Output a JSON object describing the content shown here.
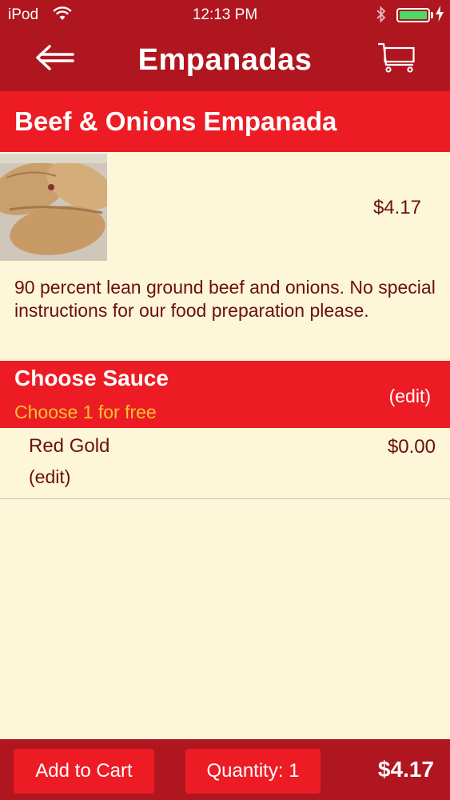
{
  "status_bar": {
    "carrier": "iPod",
    "time": "12:13 PM",
    "battery_level": 1.0,
    "icons": [
      "wifi-icon",
      "bluetooth-icon",
      "battery-icon",
      "charging-icon"
    ]
  },
  "nav": {
    "title": "Empanadas",
    "back_icon": "back-arrow-icon",
    "cart_icon": "cart-icon"
  },
  "product": {
    "name": "Beef & Onions Empanada",
    "price": "$4.17",
    "description": "90 percent lean ground beef and onions. No special instructions for our food preparation please."
  },
  "sauce_section": {
    "title": "Choose Sauce",
    "subtitle": "Choose 1 for free",
    "edit_label": "(edit)",
    "options": [
      {
        "name": "Red Gold",
        "edit_label": "(edit)",
        "price": "$0.00"
      }
    ]
  },
  "bottom_bar": {
    "add_to_cart_label": "Add to Cart",
    "quantity_label": "Quantity: 1",
    "total": "$4.17"
  },
  "colors": {
    "nav_background": "#b0161f",
    "header_background": "#ed1c24",
    "page_background": "#fdf6d8",
    "text_dark_red": "#6b0f0f",
    "subtitle_yellow": "#f6c232"
  }
}
